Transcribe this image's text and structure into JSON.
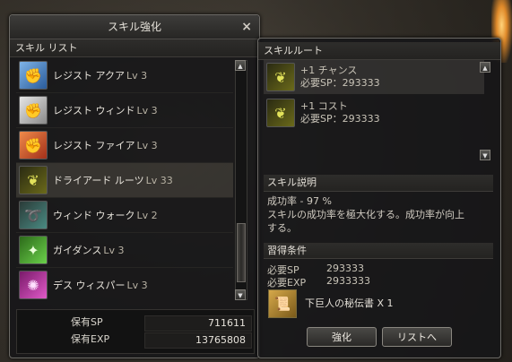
{
  "window": {
    "title": "スキル強化",
    "close_symbol": "×"
  },
  "skill_list": {
    "header": "スキル リスト",
    "items": [
      {
        "name": "レジスト アクア",
        "level": "Lv 3",
        "icon": "fist-blue-icon",
        "selected": false
      },
      {
        "name": "レジスト ウィンド",
        "level": "Lv 3",
        "icon": "fist-white-icon",
        "selected": false
      },
      {
        "name": "レジスト ファイア",
        "level": "Lv 3",
        "icon": "fist-red-icon",
        "selected": false
      },
      {
        "name": "ドライアード ルーツ",
        "level": "Lv 33",
        "icon": "vine-icon",
        "selected": true
      },
      {
        "name": "ウィンド ウォーク",
        "level": "Lv 2",
        "icon": "wind-icon",
        "selected": false
      },
      {
        "name": "ガイダンス",
        "level": "Lv 3",
        "icon": "guidance-icon",
        "selected": false
      },
      {
        "name": "デス ウィスパー",
        "level": "Lv 3",
        "icon": "death-whisper-icon",
        "selected": false
      }
    ]
  },
  "stats": {
    "sp_label": "保有SP",
    "sp_value": "711611",
    "exp_label": "保有EXP",
    "exp_value": "13765808"
  },
  "skill_route": {
    "header": "スキルルート",
    "routes": [
      {
        "name": "+1 チャンス",
        "requirement": "必要SP：293333"
      },
      {
        "name": "+1 コスト",
        "requirement": "必要SP：293333"
      }
    ]
  },
  "description": {
    "header": "スキル説明",
    "line1": "成功率 - 97 %",
    "line2": "スキルの成功率を極大化する。成功率が向上",
    "line3": "する。"
  },
  "conditions": {
    "header": "習得条件",
    "sp_label": "必要SP",
    "sp_value": "293333",
    "exp_label": "必要EXP",
    "exp_value": "2933333",
    "item_name": "下巨人の秘伝書 X 1"
  },
  "buttons": {
    "enhance": "強化",
    "to_list": "リストへ"
  },
  "colors": {
    "panel_bg": "#161618",
    "border": "#6c6a66",
    "text": "#d8d4cc",
    "selected_row": "#6e6a5a"
  }
}
